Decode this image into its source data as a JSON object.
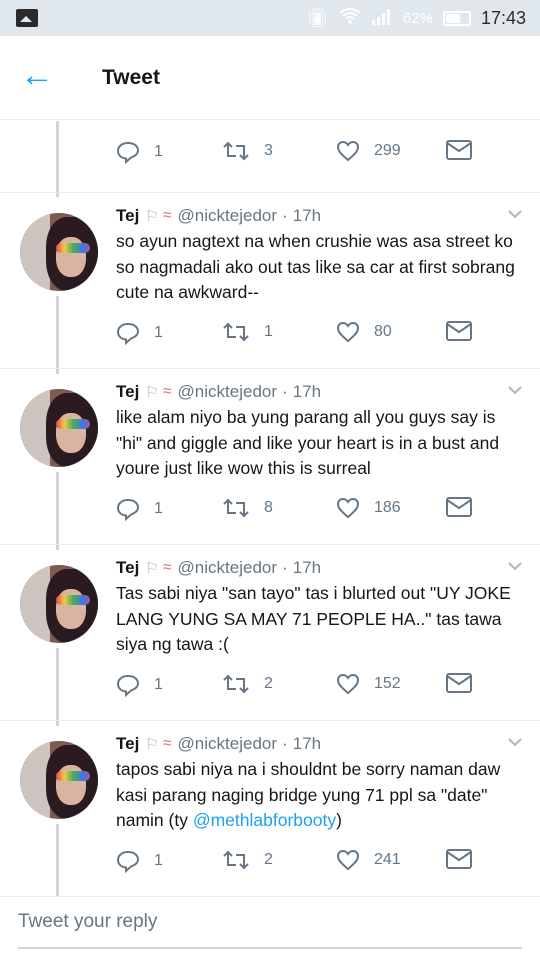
{
  "status_bar": {
    "battery_percent": "62%",
    "time": "17:43",
    "icons": [
      "gallery-icon",
      "vibrate-icon",
      "wifi-icon",
      "signal-icon",
      "battery-icon"
    ]
  },
  "header": {
    "title": "Tweet",
    "back_icon": "arrow-left-icon"
  },
  "accent_color": "#1da1f2",
  "partial_tweet": {
    "replies": "1",
    "retweets": "3",
    "likes": "299"
  },
  "tweets": [
    {
      "name": "Tej",
      "handle": "@nicktejedor",
      "time": "17h",
      "text": "so ayun nagtext na when crushie was asa street ko so nagmadali ako out tas like sa car at first sobrang cute na awkward--",
      "mention": "",
      "text_after": "",
      "replies": "1",
      "retweets": "1",
      "likes": "80"
    },
    {
      "name": "Tej",
      "handle": "@nicktejedor",
      "time": "17h",
      "text": "like alam niyo ba yung parang all you guys say is \"hi\" and giggle and like your heart is in a bust and youre just like wow this is surreal",
      "mention": "",
      "text_after": "",
      "replies": "1",
      "retweets": "8",
      "likes": "186"
    },
    {
      "name": "Tej",
      "handle": "@nicktejedor",
      "time": "17h",
      "text": "Tas sabi niya \"san tayo\" tas i blurted out \"UY JOKE LANG YUNG SA MAY 71 PEOPLE HA..\" tas tawa siya ng tawa :(",
      "mention": "",
      "text_after": "",
      "replies": "1",
      "retweets": "2",
      "likes": "152"
    },
    {
      "name": "Tej",
      "handle": "@nicktejedor",
      "time": "17h",
      "text": "tapos sabi niya na i shouldnt be sorry naman daw kasi parang naging bridge yung 71 ppl sa \"date\" namin (ty ",
      "mention": "@methlabforbooty",
      "text_after": ")",
      "replies": "1",
      "retweets": "2",
      "likes": "241"
    }
  ],
  "reply": {
    "placeholder": "Tweet your reply"
  }
}
